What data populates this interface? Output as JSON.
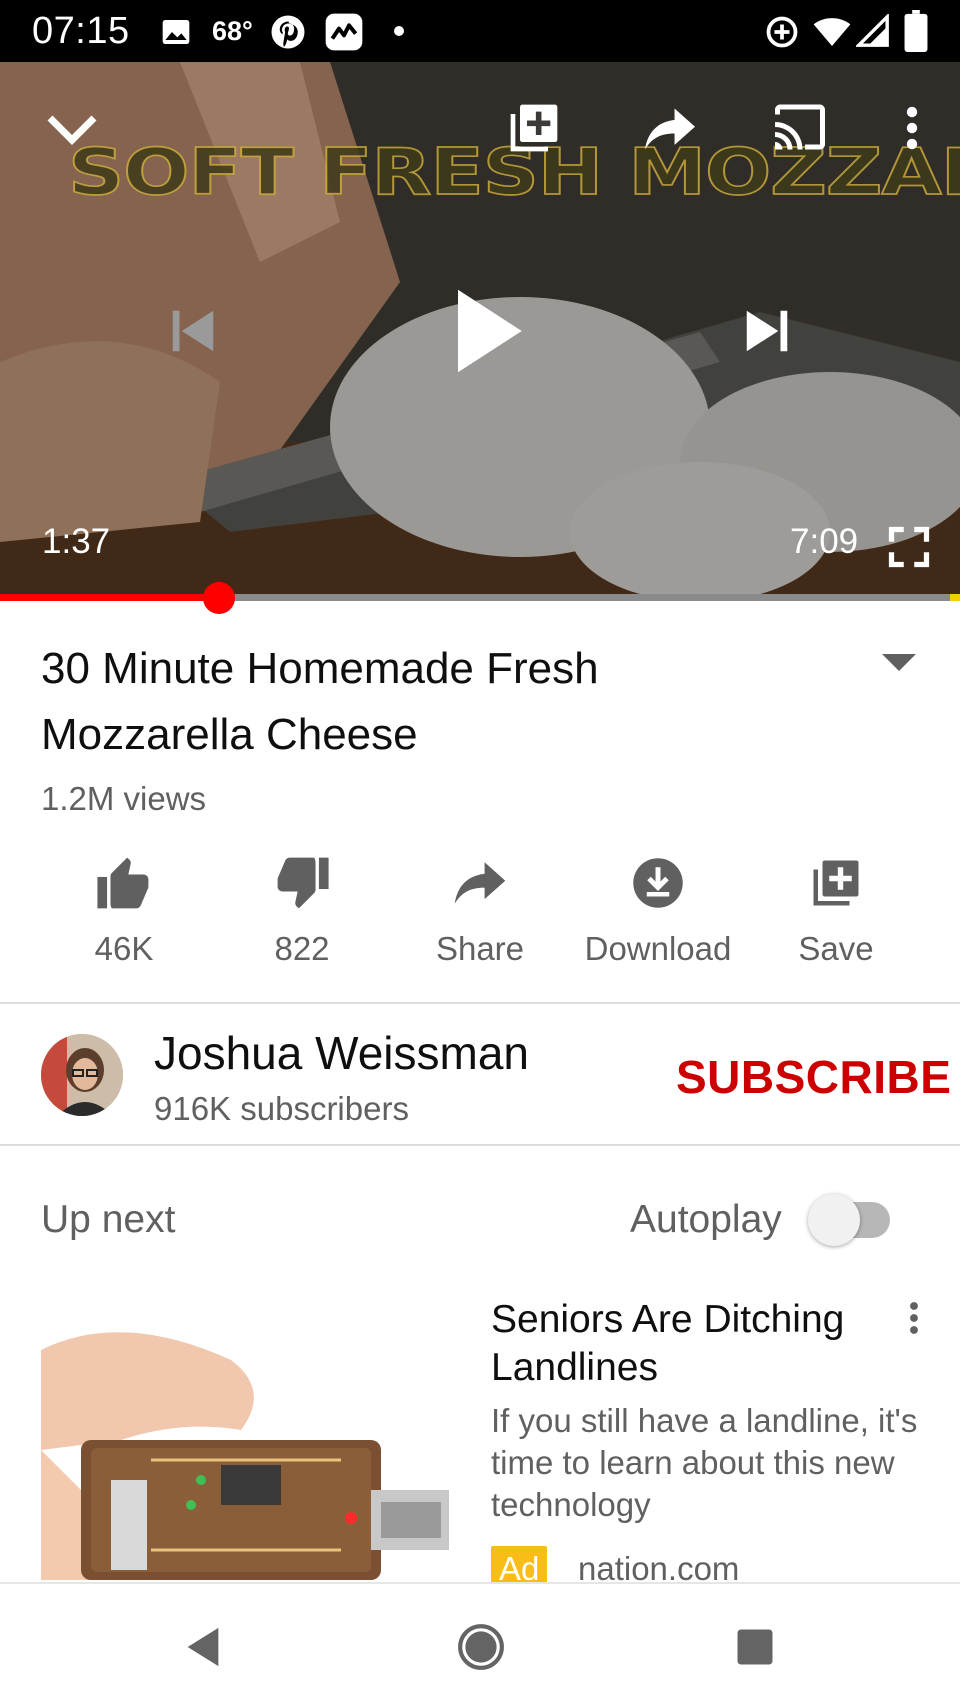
{
  "status_bar": {
    "time": "07:15",
    "temperature": "68°",
    "icons": [
      "image-icon",
      "pinterest-icon",
      "stocks-app-icon",
      "notification-dot",
      "add-circle-icon",
      "wifi-icon",
      "signal-icon",
      "battery-icon"
    ]
  },
  "player": {
    "overlay_text": "SOFT FRESH MOZZARELLA",
    "current_time": "1:37",
    "total_time": "7:09",
    "progress_fraction": 0.228,
    "controls": [
      "minimize-icon",
      "add-to-playlist-icon",
      "share-icon",
      "cast-icon",
      "more-options-icon",
      "previous-icon",
      "play-icon",
      "next-icon",
      "fullscreen-icon"
    ]
  },
  "video": {
    "title": "30 Minute Homemade Fresh Mozzarella Cheese",
    "views": "1.2M views"
  },
  "actions": [
    {
      "label": "46K",
      "icon": "thumbs-up-icon"
    },
    {
      "label": "822",
      "icon": "thumbs-down-icon"
    },
    {
      "label": "Share",
      "icon": "share-icon"
    },
    {
      "label": "Download",
      "icon": "download-icon"
    },
    {
      "label": "Save",
      "icon": "save-icon"
    }
  ],
  "channel": {
    "name": "Joshua Weissman",
    "subscribers": "916K subscribers",
    "subscribe_label": "SUBSCRIBE"
  },
  "up_next": {
    "label": "Up next",
    "autoplay_label": "Autoplay",
    "autoplay_on": false
  },
  "ad_card": {
    "title": "Seniors Are Ditching Landlines",
    "description": "If you still have a landline, it's time to learn about this new technology",
    "badge": "Ad",
    "domain": "nation.com"
  },
  "colors": {
    "accent_red": "#ff0000",
    "subscribe_red": "#cc0000",
    "ad_yellow": "#f9bd18",
    "secondary_text": "#606060"
  }
}
